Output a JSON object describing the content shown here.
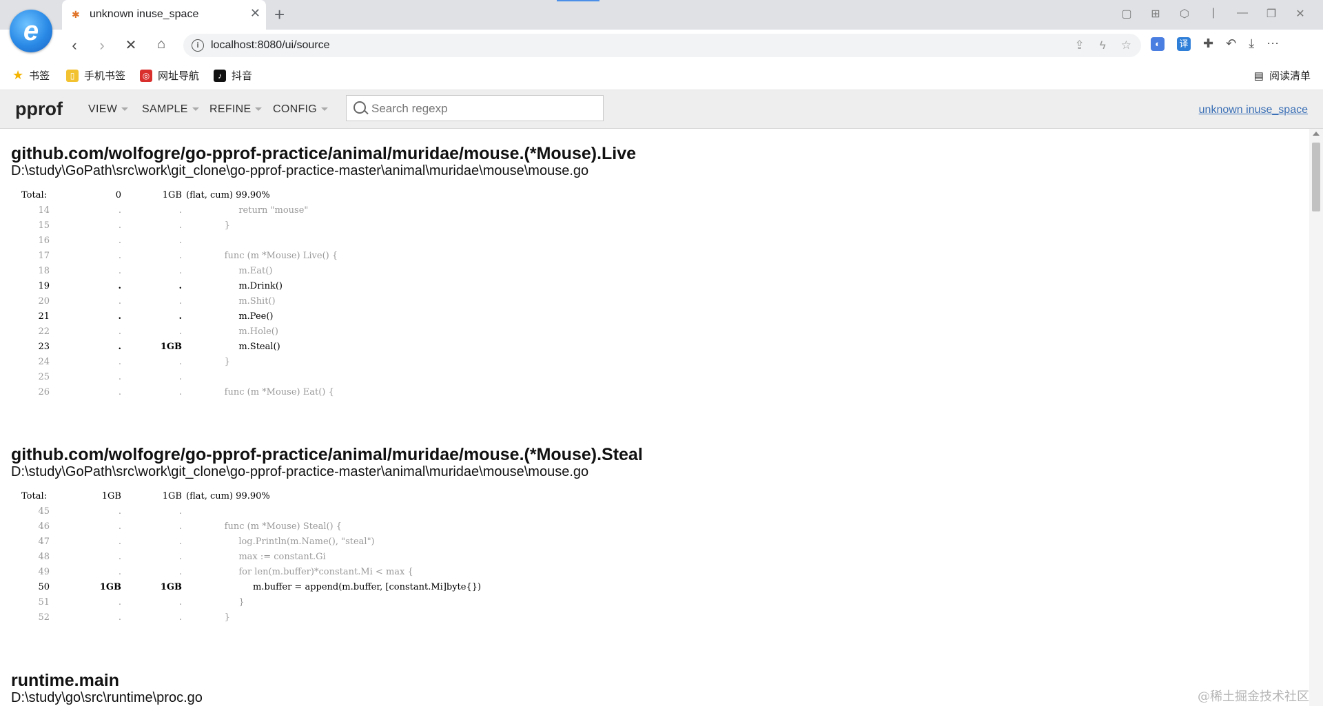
{
  "browser": {
    "tab_title": "unknown inuse_space",
    "tab_close": "✕",
    "new_tab": "+",
    "url": "localhost:8080/ui/source",
    "bookmarks": [
      {
        "label": "书签",
        "icon": "star-icon"
      },
      {
        "label": "手机书签",
        "icon": "phone-bookmark-icon"
      },
      {
        "label": "网址导航",
        "icon": "web-nav-icon"
      },
      {
        "label": "抖音",
        "icon": "douyin-icon"
      }
    ],
    "reading_list": "阅读清单"
  },
  "pprof": {
    "title": "pprof",
    "menus": [
      "VIEW",
      "SAMPLE",
      "REFINE",
      "CONFIG"
    ],
    "search_placeholder": "Search regexp",
    "profile_link": "unknown inuse_space"
  },
  "sections": [
    {
      "function": "github.com/wolfogre/go-pprof-practice/animal/muridae/mouse.(*Mouse).Live",
      "file": "D:\\study\\GoPath\\src\\work\\git_clone\\go-pprof-practice-master\\animal\\muridae\\mouse\\mouse.go",
      "total": {
        "label": "Total:",
        "flat": "0",
        "cum": "1GB",
        "rest": "(flat, cum) 99.90%"
      },
      "lines": [
        {
          "num": "14",
          "flat": ".",
          "cum": ".",
          "src": "\t\treturn \"mouse\"",
          "hot": false
        },
        {
          "num": "15",
          "flat": ".",
          "cum": ".",
          "src": "\t}",
          "hot": false
        },
        {
          "num": "16",
          "flat": ".",
          "cum": ".",
          "src": "",
          "hot": false
        },
        {
          "num": "17",
          "flat": ".",
          "cum": ".",
          "src": "\tfunc (m *Mouse) Live() {",
          "hot": false
        },
        {
          "num": "18",
          "flat": ".",
          "cum": ".",
          "src": "\t\tm.Eat()",
          "hot": false
        },
        {
          "num": "19",
          "flat": ".",
          "cum": ".",
          "src": "\t\tm.Drink()",
          "hot": true
        },
        {
          "num": "20",
          "flat": ".",
          "cum": ".",
          "src": "\t\tm.Shit()",
          "hot": false
        },
        {
          "num": "21",
          "flat": ".",
          "cum": ".",
          "src": "\t\tm.Pee()",
          "hot": true
        },
        {
          "num": "22",
          "flat": ".",
          "cum": ".",
          "src": "\t\tm.Hole()",
          "hot": false
        },
        {
          "num": "23",
          "flat": ".",
          "cum": "1GB",
          "src": "\t\tm.Steal()",
          "hot": true
        },
        {
          "num": "24",
          "flat": ".",
          "cum": ".",
          "src": "\t}",
          "hot": false
        },
        {
          "num": "25",
          "flat": ".",
          "cum": ".",
          "src": "",
          "hot": false
        },
        {
          "num": "26",
          "flat": ".",
          "cum": ".",
          "src": "\tfunc (m *Mouse) Eat() {",
          "hot": false
        }
      ]
    },
    {
      "function": "github.com/wolfogre/go-pprof-practice/animal/muridae/mouse.(*Mouse).Steal",
      "file": "D:\\study\\GoPath\\src\\work\\git_clone\\go-pprof-practice-master\\animal\\muridae\\mouse\\mouse.go",
      "total": {
        "label": "Total:",
        "flat": "1GB",
        "cum": "1GB",
        "rest": "(flat, cum) 99.90%"
      },
      "lines": [
        {
          "num": "45",
          "flat": ".",
          "cum": ".",
          "src": "",
          "hot": false
        },
        {
          "num": "46",
          "flat": ".",
          "cum": ".",
          "src": "\tfunc (m *Mouse) Steal() {",
          "hot": false
        },
        {
          "num": "47",
          "flat": ".",
          "cum": ".",
          "src": "\t\tlog.Println(m.Name(), \"steal\")",
          "hot": false
        },
        {
          "num": "48",
          "flat": ".",
          "cum": ".",
          "src": "\t\tmax := constant.Gi",
          "hot": false
        },
        {
          "num": "49",
          "flat": ".",
          "cum": ".",
          "src": "\t\tfor len(m.buffer)*constant.Mi < max {",
          "hot": false
        },
        {
          "num": "50",
          "flat": "1GB",
          "cum": "1GB",
          "src": "\t\t\tm.buffer = append(m.buffer, [constant.Mi]byte{})",
          "hot": true
        },
        {
          "num": "51",
          "flat": ".",
          "cum": ".",
          "src": "\t\t}",
          "hot": false
        },
        {
          "num": "52",
          "flat": ".",
          "cum": ".",
          "src": "\t}",
          "hot": false
        }
      ]
    },
    {
      "function": "runtime.main",
      "file": "D:\\study\\go\\src\\runtime\\proc.go",
      "total": null,
      "lines": []
    }
  ],
  "watermark": "@稀土掘金技术社区"
}
